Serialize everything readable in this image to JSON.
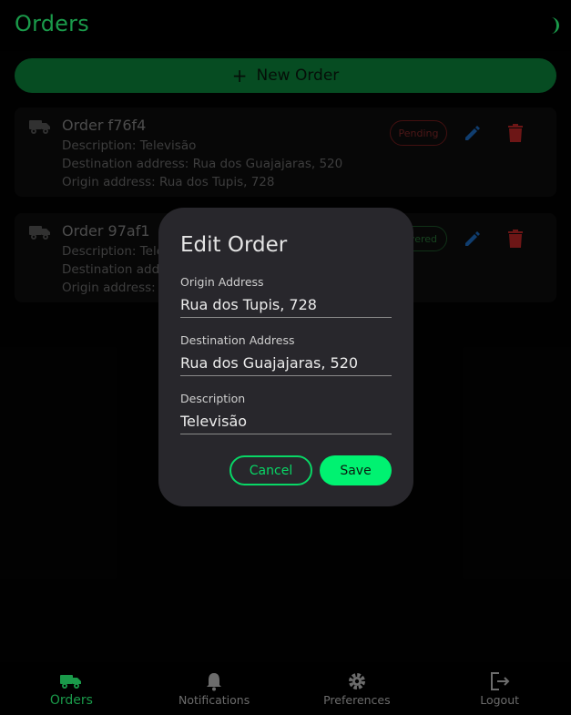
{
  "header": {
    "title": "Orders",
    "theme_icon": "moon-icon"
  },
  "actions": {
    "new_order_plus": "+",
    "new_order_label": "New Order"
  },
  "orders": [
    {
      "title": "Order f76f4",
      "description": "Description: Televisão",
      "destination": "Destination address: Rua dos Guajajaras, 520",
      "origin": "Origin address: Rua dos Tupis, 728",
      "status": "Pending",
      "status_color": "#7a1e1e"
    },
    {
      "title": "Order 97af1",
      "description": "Description: Tele",
      "destination": "Destination addr",
      "origin": "Origin address: R",
      "status": "vered",
      "status_color": "#1e5a2a"
    }
  ],
  "dialog": {
    "title": "Edit Order",
    "origin_label": "Origin Address",
    "origin_value": "Rua dos Tupis, 728",
    "destination_label": "Destination Address",
    "destination_value": "Rua dos Guajajaras, 520",
    "description_label": "Description",
    "description_value": "Televisão",
    "cancel_label": "Cancel",
    "save_label": "Save"
  },
  "nav": {
    "items": [
      {
        "label": "Orders",
        "icon": "truck-icon",
        "active": true
      },
      {
        "label": "Notifications",
        "icon": "bell-icon",
        "active": false
      },
      {
        "label": "Preferences",
        "icon": "gear-icon",
        "active": false
      },
      {
        "label": "Logout",
        "icon": "logout-icon",
        "active": false
      }
    ]
  },
  "colors": {
    "accent": "#1a9a4a",
    "accent_bright": "#00f271",
    "danger": "#c62828",
    "edit": "#1e6fc9"
  }
}
